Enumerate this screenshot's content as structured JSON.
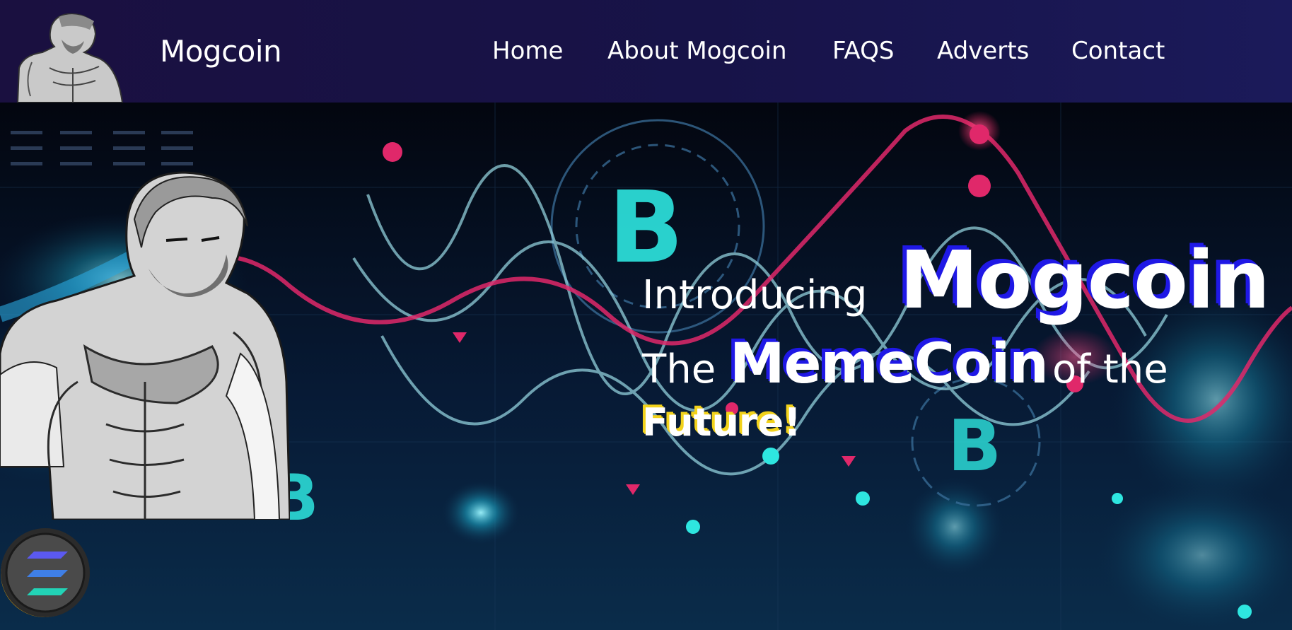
{
  "header": {
    "brand": "Mogcoin",
    "logo_icon": "mogcoin-character-icon",
    "nav": [
      "Home",
      "About Mogcoin",
      "FAQS",
      "Adverts",
      "Contact"
    ]
  },
  "hero": {
    "line1_prefix": "Introducing",
    "line1_highlight": "Mogcoin",
    "line2_prefix": "The",
    "line2_highlight": "MemeCoin",
    "line2_suffix": "of the",
    "line3": "Future!",
    "character_icon": "muscular-bearded-man-illustration",
    "coin_left_icon": "bitcoin-gold-coin-icon",
    "coin_right_icon": "solana-coin-icon",
    "background": "crypto-chart-waves-background"
  },
  "colors": {
    "header_bg": "#1a1144",
    "text": "#ffffff",
    "highlight_shadow": "#1f18e6",
    "future_shadow": "#f2d21a",
    "wave_cyan": "#3bd9e6",
    "wave_pink": "#e0286a"
  }
}
